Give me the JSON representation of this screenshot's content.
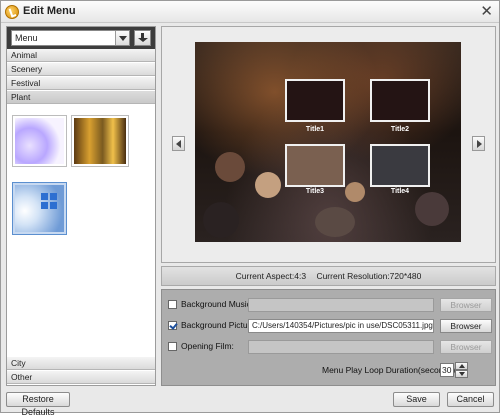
{
  "window": {
    "title": "Edit Menu"
  },
  "left_panel": {
    "template_select": "Menu",
    "categories_top": [
      "Animal",
      "Scenery",
      "Festival",
      "Plant"
    ],
    "categories_bottom": [
      "City",
      "Other"
    ]
  },
  "preview": {
    "titles": [
      "Title1",
      "Title2",
      "Title3",
      "Title4"
    ]
  },
  "info": {
    "aspect": "Current Aspect:4:3",
    "resolution": "Current Resolution:720*480"
  },
  "settings": {
    "background_music": {
      "label": "Background Music:",
      "checked": false,
      "value": "",
      "button": "Browser"
    },
    "background_picture": {
      "label": "Background Picture:",
      "checked": true,
      "value": "C:/Users/140354/Pictures/pic in use/DSC05311.jpg",
      "button": "Browser"
    },
    "opening_film": {
      "label": "Opening Film:",
      "checked": false,
      "value": "",
      "button": "Browser"
    },
    "loop": {
      "label": "Menu Play Loop Duration(seconds):",
      "value": "30"
    }
  },
  "buttons": {
    "restore": "Restore Defaults",
    "save": "Save",
    "cancel": "Cancel"
  },
  "colors": {
    "toolbar": "#3d3d3d",
    "settings_bg": "#adadad",
    "selected_thumb": "#c7d9f1"
  }
}
